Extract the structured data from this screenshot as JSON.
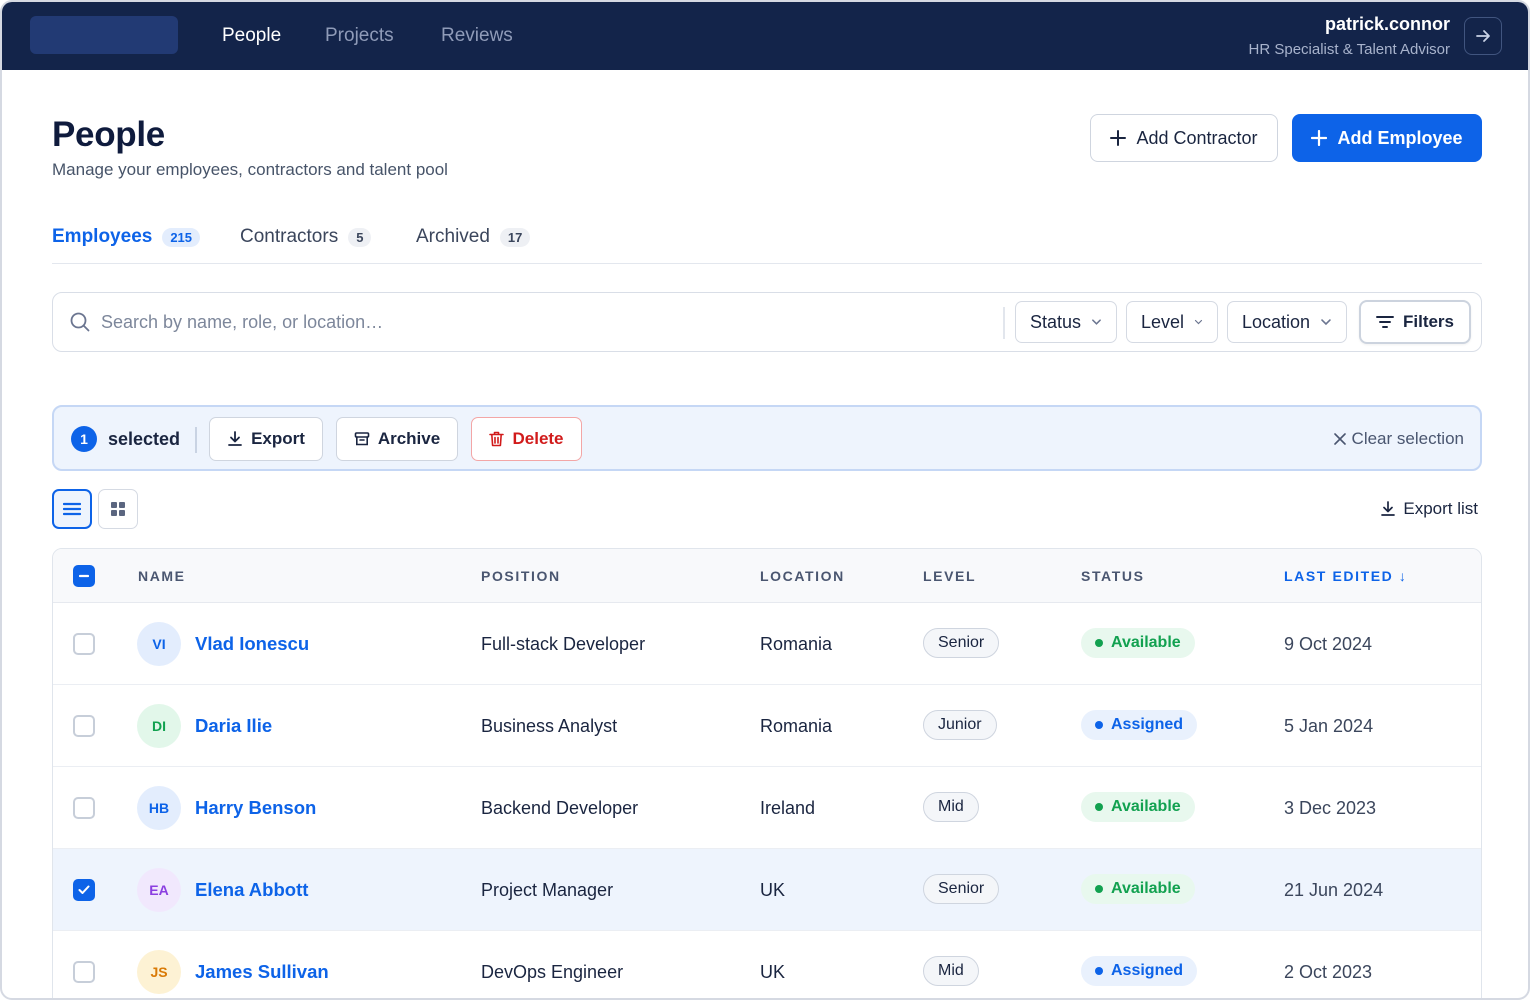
{
  "nav": {
    "links": [
      "People",
      "Projects",
      "Reviews"
    ],
    "active": "People"
  },
  "user": {
    "name": "patrick.connor",
    "role": "HR Specialist & Talent Advisor",
    "logout_icon": "arrow-right-icon"
  },
  "header": {
    "title": "People",
    "subtitle": "Manage your employees, contractors and talent pool",
    "add_contractor": "Add Contractor",
    "add_employee": "Add Employee"
  },
  "tabs": [
    {
      "label": "Employees",
      "count": "215",
      "active": true
    },
    {
      "label": "Contractors",
      "count": "5",
      "active": false
    },
    {
      "label": "Archived",
      "count": "17",
      "active": false
    }
  ],
  "search": {
    "placeholder": "Search by name, role, or location…",
    "value": ""
  },
  "filters": {
    "status": "Status",
    "level": "Level",
    "location": "Location",
    "filters_button": "Filters"
  },
  "selection": {
    "count": "1",
    "label": "selected",
    "export": "Export",
    "archive": "Archive",
    "delete": "Delete",
    "clear": "Clear selection"
  },
  "toolbar": {
    "export_list": "Export list"
  },
  "table": {
    "columns": {
      "name": "NAME",
      "position": "POSITION",
      "location": "LOCATION",
      "level": "LEVEL",
      "status": "STATUS",
      "last_edited": "LAST EDITED ↓"
    },
    "rows": [
      {
        "initials": "VI",
        "name": "Vlad Ionescu",
        "position": "Full-stack Developer",
        "location": "Romania",
        "level": "Senior",
        "status": "Available",
        "last_edited": "9 Oct 2024",
        "selected": false
      },
      {
        "initials": "DI",
        "name": "Daria Ilie",
        "position": "Business Analyst",
        "location": "Romania",
        "level": "Junior",
        "status": "Assigned",
        "last_edited": "5 Jan 2024",
        "selected": false
      },
      {
        "initials": "HB",
        "name": "Harry Benson",
        "position": "Backend Developer",
        "location": "Ireland",
        "level": "Mid",
        "status": "Available",
        "last_edited": "3 Dec 2023",
        "selected": false
      },
      {
        "initials": "EA",
        "name": "Elena Abbott",
        "position": "Project Manager",
        "location": "UK",
        "level": "Senior",
        "status": "Available",
        "last_edited": "21 Jun 2024",
        "selected": true
      },
      {
        "initials": "JS",
        "name": "James Sullivan",
        "position": "DevOps Engineer",
        "location": "UK",
        "level": "Mid",
        "status": "Assigned",
        "last_edited": "2 Oct 2023",
        "selected": false
      }
    ]
  },
  "colors": {
    "nav_bg": "#13244a",
    "accent": "#0d63e8",
    "available": "#12a150",
    "assigned": "#0d63e8",
    "danger": "#d11b1b"
  }
}
